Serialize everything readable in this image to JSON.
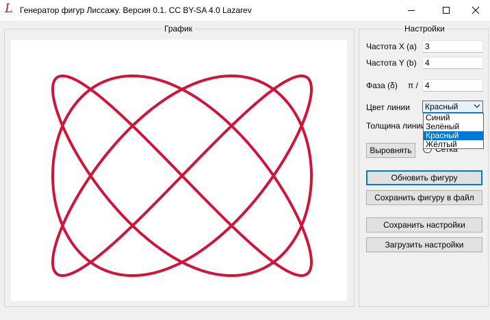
{
  "window": {
    "title": "Генератор фигур Лиссажу. Версия 0.1. CC BY-SA 4.0 Lazarev",
    "icon_glyph": "L"
  },
  "graph_group": {
    "title": "График"
  },
  "settings_group": {
    "title": "Настройки",
    "freq_x_label": "Частота X (a)",
    "freq_x_value": "3",
    "freq_y_label": "Частота Y (b)",
    "freq_y_value": "4",
    "phase_label": "Фаза (δ)",
    "phase_unit": "π /",
    "phase_value": "4",
    "color_label": "Цвет линии",
    "color_selected": "Красный",
    "color_options": [
      "Синий",
      "Зелёный",
      "Красный",
      "Жёлтый"
    ],
    "thickness_label": "Толщина линии",
    "align_button": "Выровнять",
    "grid_label": "Сетка",
    "update_button": "Обновить фигуру",
    "save_figure_button": "Сохранить фигуру в файл",
    "save_settings_button": "Сохранить настройки",
    "load_settings_button": "Загрузить настройки"
  },
  "figure": {
    "a": 3,
    "b": 4,
    "phase_divisor": 4,
    "line_color": "#d2143a"
  },
  "icons": [
    "app-logo-icon",
    "minimize-icon",
    "maximize-icon",
    "close-icon",
    "chevron-down-icon"
  ]
}
